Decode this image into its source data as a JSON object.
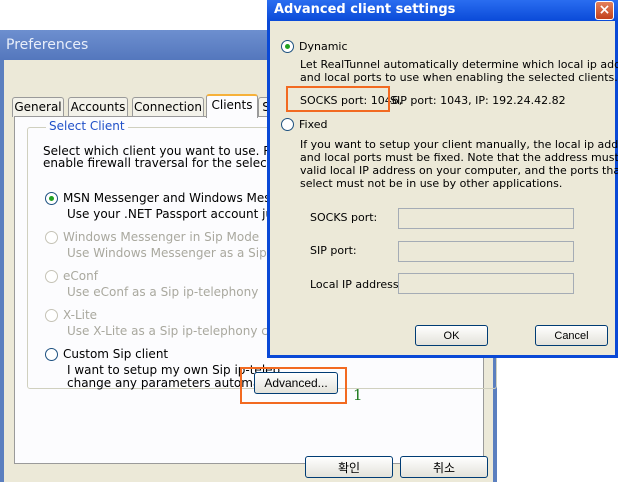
{
  "preferences": {
    "title": "Preferences",
    "tabs": [
      "General",
      "Accounts",
      "Connection",
      "Clients",
      "S"
    ],
    "active_tab": "Clients",
    "group_label": "Select Client",
    "intro": [
      "Select which client you want to use. Re",
      "enable firewall traversal for the selected"
    ],
    "clients": [
      {
        "name": "MSN Messenger and Windows Messe",
        "desc": "Use your .NET Passport account jus",
        "selected": true,
        "enabled": true
      },
      {
        "name": "Windows Messenger in Sip Mode",
        "desc": "Use Windows Messenger as a Sip i",
        "selected": false,
        "enabled": false
      },
      {
        "name": "eConf",
        "desc": "Use eConf as a Sip ip-telephony",
        "selected": false,
        "enabled": false
      },
      {
        "name": "X-Lite",
        "desc": "Use X-Lite as a Sip ip-telephony cli",
        "selected": false,
        "enabled": false
      },
      {
        "name": "Custom Sip client",
        "desc": "I want to setup my own Sip ip-telep",
        "desc2": "change any parameters automaticall",
        "selected": false,
        "enabled": true
      }
    ],
    "advanced_button": "Advanced...",
    "ok_button": "확인",
    "cancel_button": "취소"
  },
  "annotation_number": "1",
  "advanced_dialog": {
    "title": "Advanced client settings",
    "close_glyph": "×",
    "dynamic_label": "Dynamic",
    "dynamic_desc": [
      "Let RealTunnel automatically determine which local ip address",
      "and local ports to use when enabling the selected clients."
    ],
    "ports_socks": "SOCKS port: 1046,",
    "ports_rest": " SIP port: 1043, IP: 192.24.42.82",
    "fixed_label": "Fixed",
    "fixed_desc": [
      "If you want to setup your client manually, the local ip address",
      "and local ports must be fixed.  Note that the address must be a",
      "valid local IP address on your computer, and the ports that you",
      "select must not be in use by other applications."
    ],
    "socks_label": "SOCKS port:",
    "sip_label": "SIP port:",
    "ip_label": "Local IP address:",
    "socks_value": "",
    "sip_value": "",
    "ip_value": "",
    "ok_button": "OK",
    "cancel_button": "Cancel",
    "mode": "dynamic"
  },
  "colors": {
    "xp_titlebar": "#0a49d6",
    "highlight": "#f26a21",
    "selected_radio": "#21a121"
  }
}
